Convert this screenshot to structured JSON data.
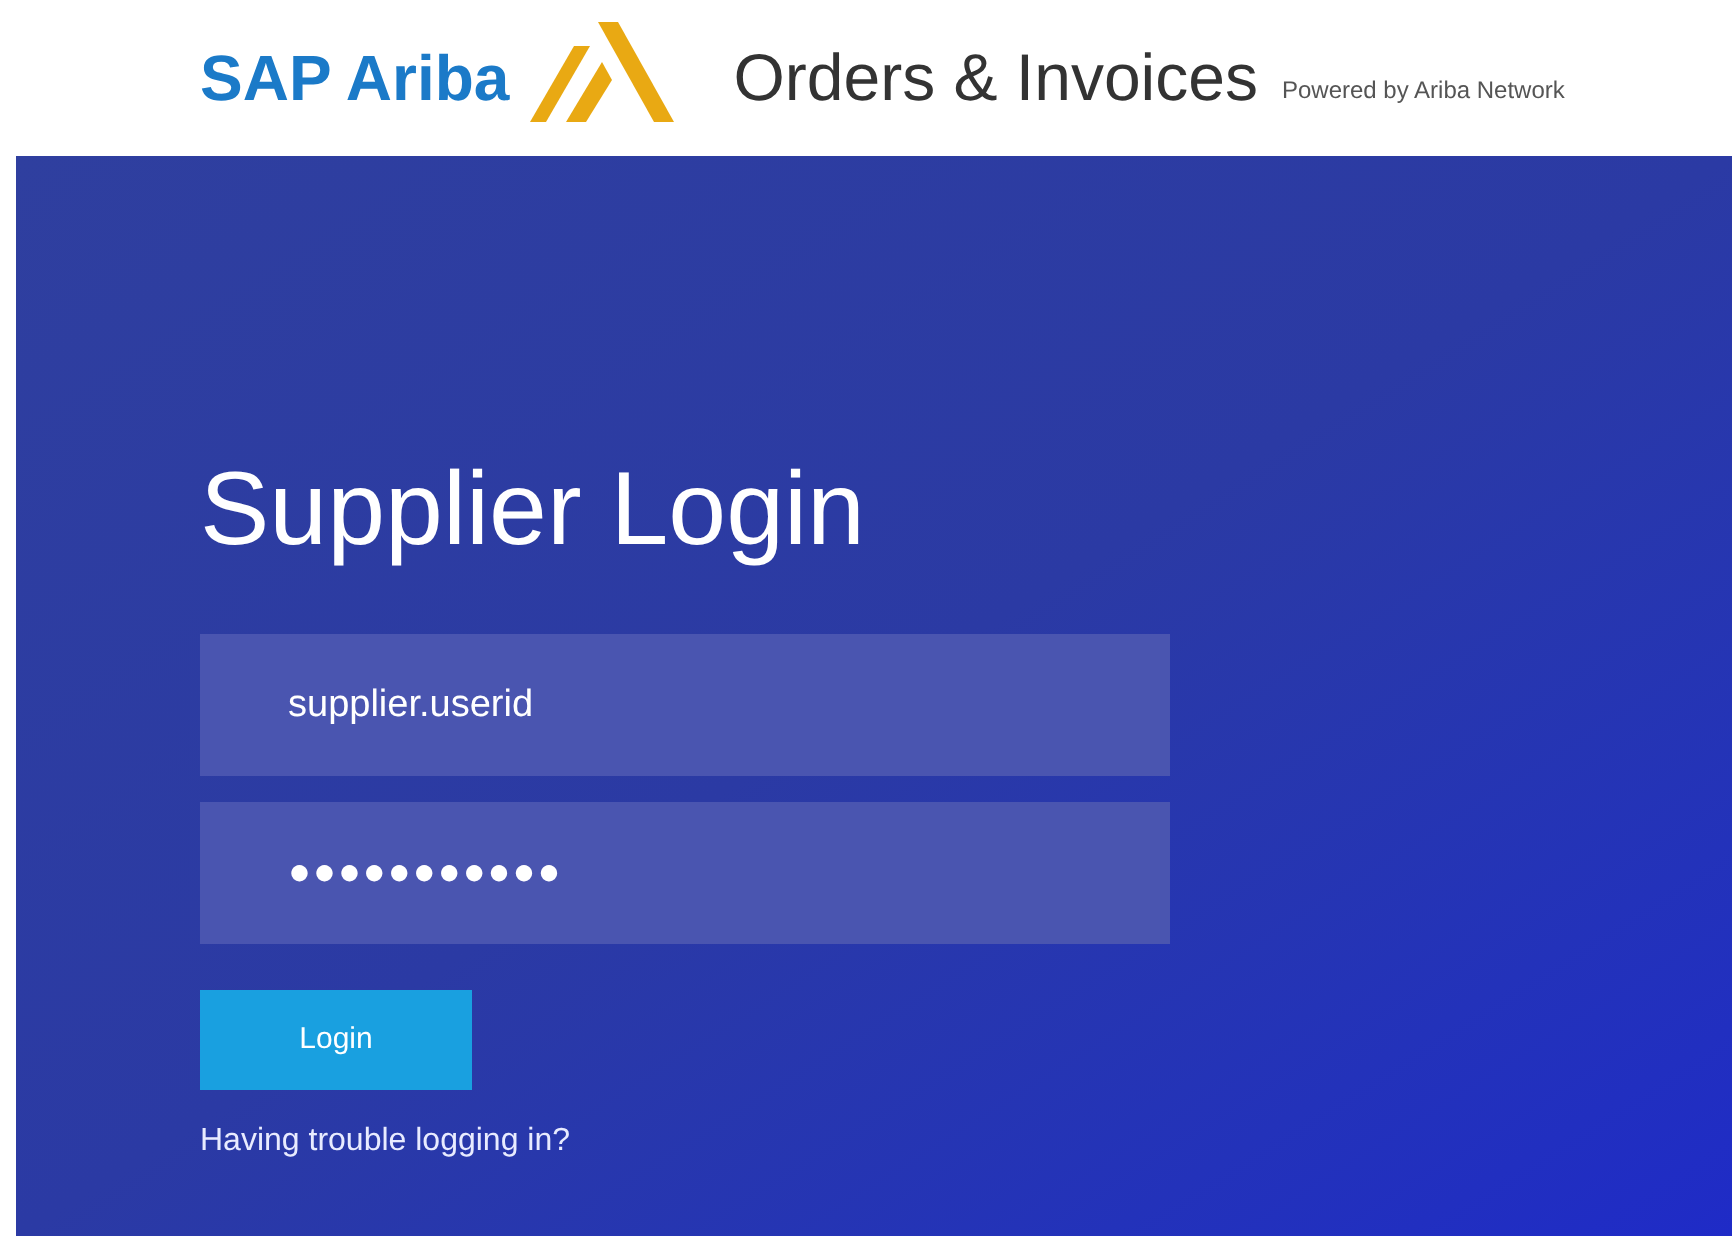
{
  "header": {
    "brand": "SAP Ariba",
    "product": "Orders & Invoices",
    "powered_by": "Powered by Ariba Network"
  },
  "login": {
    "title": "Supplier Login",
    "fields": [
      {
        "kind": "text",
        "value": "supplier.userid"
      },
      {
        "kind": "password",
        "value": "●●●●●●●●●●●"
      }
    ],
    "button": "Login",
    "help_link": "Having trouble logging in?"
  }
}
